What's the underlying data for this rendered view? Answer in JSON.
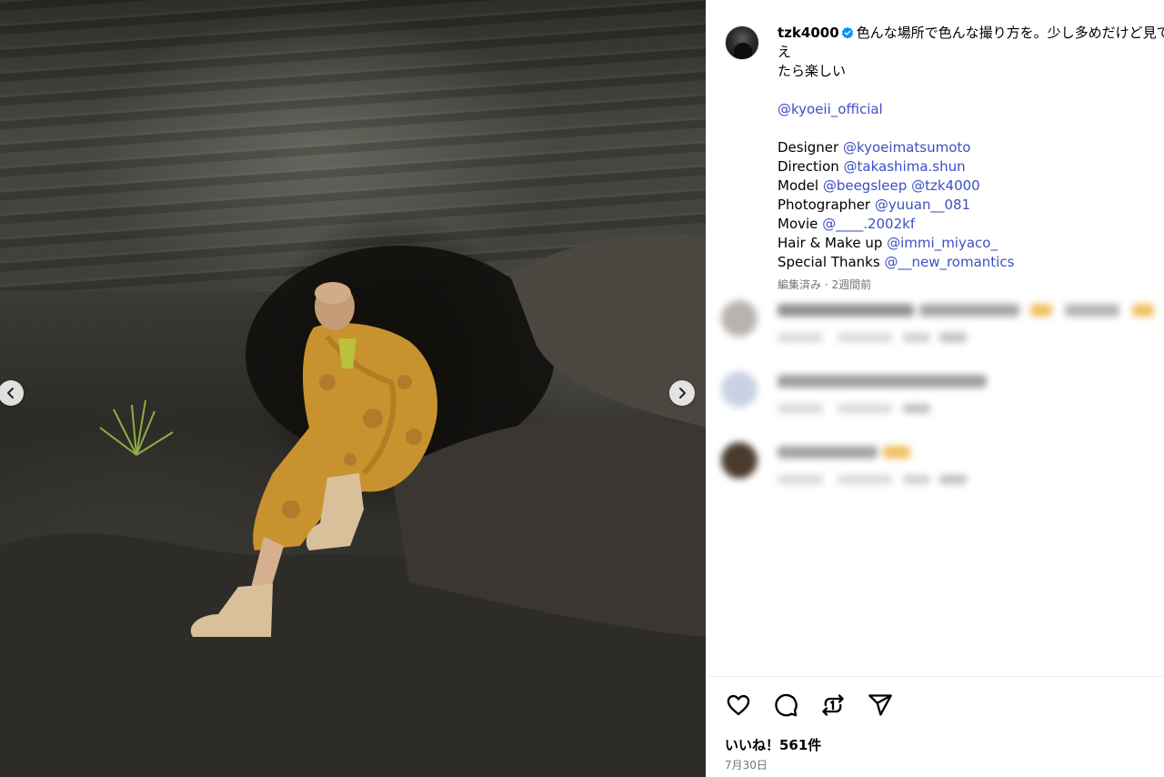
{
  "post": {
    "image_alt": "Model in mustard patterned coat and fur boots sitting on dark rocks",
    "prev_icon": "chevron-left-icon",
    "next_icon": "chevron-right-icon"
  },
  "caption": {
    "username": "tzk4000",
    "verified": true,
    "text_line1": "色んな場所で色んな撮り方を。少し多めだけど見てもらえ",
    "text_line2": "たら楽しい",
    "brand_mention": "@kyoeii_official",
    "credits": [
      {
        "role": "Designer",
        "handles": [
          "@kyoeimatsumoto"
        ]
      },
      {
        "role": "Direction",
        "handles": [
          "@takashima.shun"
        ]
      },
      {
        "role": "Model",
        "handles": [
          "@beegsleep",
          "@tzk4000"
        ]
      },
      {
        "role": "Photographer",
        "handles": [
          "@yuuan__081"
        ]
      },
      {
        "role": "Movie",
        "handles": [
          "@____.2002kf"
        ]
      },
      {
        "role": "Hair & Make up",
        "handles": [
          "@immi_miyaco_"
        ]
      },
      {
        "role": "Special Thanks",
        "handles": [
          "@__new_romantics"
        ]
      }
    ],
    "meta": "編集済み · 2週間前"
  },
  "actions": {
    "like_icon": "heart-icon",
    "comment_icon": "comment-icon",
    "repost_icon": "repost-icon",
    "share_icon": "share-icon"
  },
  "likes_text": "いいね！561件",
  "date_text": "7月30日",
  "colors": {
    "link": "#3d4fc4",
    "verified": "#0095f6",
    "muted": "#737373",
    "coat": "#c8922f"
  }
}
